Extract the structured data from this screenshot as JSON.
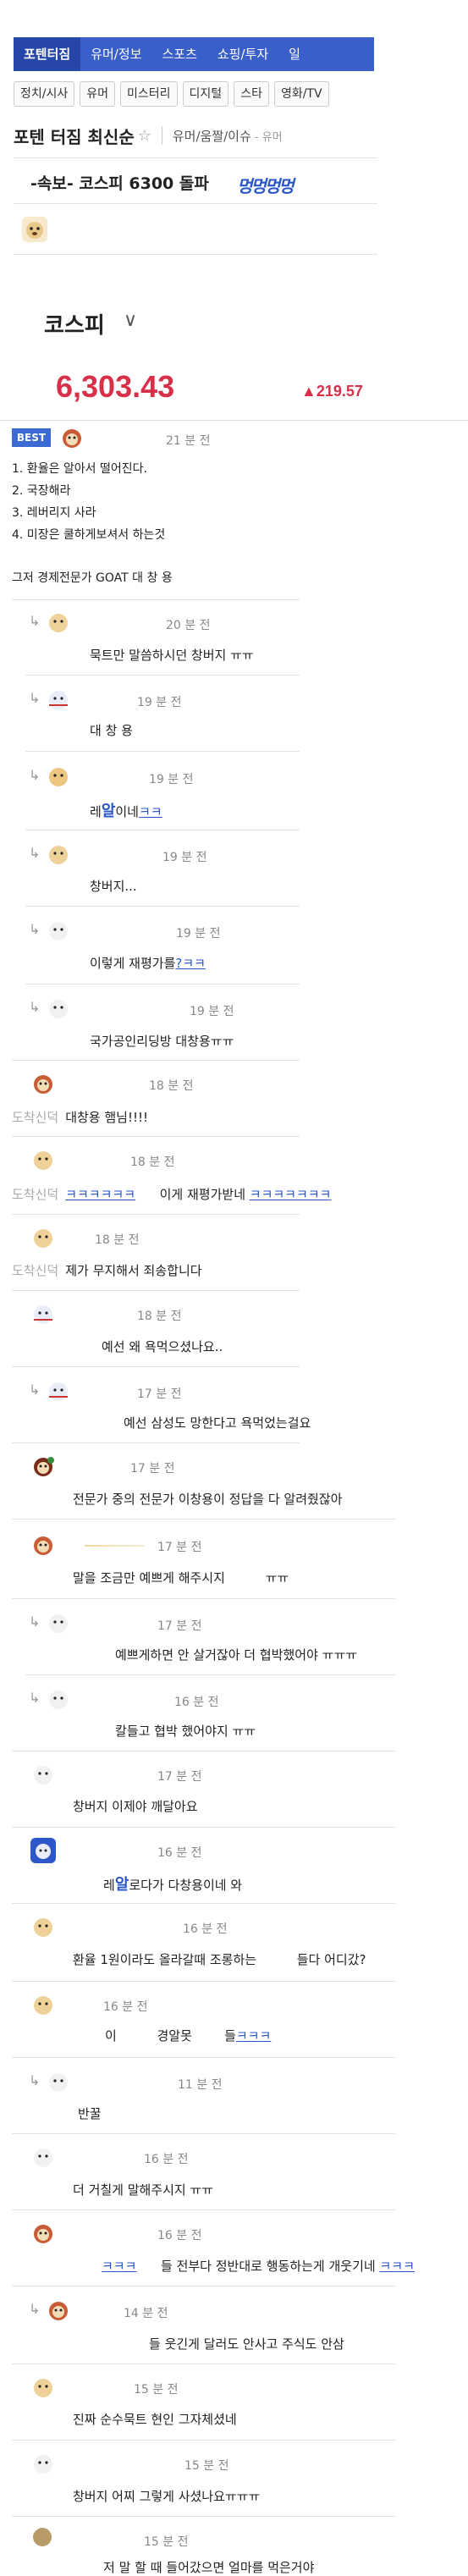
{
  "nav": {
    "tabs": [
      "포텐터짐",
      "유머/정보",
      "스포츠",
      "쇼핑/투자",
      "일"
    ],
    "chips": [
      "정치/시사",
      "유머",
      "미스터리",
      "디지털",
      "스타",
      "영화/TV"
    ]
  },
  "board": {
    "name": "포텐 터짐 최신순",
    "star": "☆",
    "category": "유머/움짤/이슈",
    "sub": "- 유머"
  },
  "post": {
    "title": "-속보- 코스피 6300 돌파",
    "title_scribble": "멍멍멍멍"
  },
  "stock": {
    "label": "코스피",
    "chevron": "∨",
    "value": "6,303.43",
    "change": "▲219.57"
  },
  "best_badge": "BEST",
  "comments": [
    {
      "time": "21 분 전",
      "lines": [
        "1. 환율은 알아서 떨어진다.",
        "2. 국장해라",
        "3. 레버리지 사라",
        "4. 미장은 쿨하게보셔서 하는것",
        "",
        "그저 경제전문가 GOAT 대 창 용"
      ]
    },
    {
      "time": "20 분 전",
      "text": "묵트만 말씀하시던 창버지 ㅠㅠ"
    },
    {
      "time": "19 분 전",
      "text": "대 창 용"
    },
    {
      "time": "19 분 전",
      "text": "레",
      "scribble": "알",
      "tail": "이네",
      "blue": "ㅋㅋ"
    },
    {
      "time": "19 분 전",
      "text": "창버지..."
    },
    {
      "time": "19 분 전",
      "text": "이렇게 재평가를",
      "blue": "?ㅋㅋ"
    },
    {
      "time": "19 분 전",
      "text": "국가공인리딩방 대창용ㅠㅠ"
    },
    {
      "time": "18 분 전",
      "nick": "도착신덕",
      "text": "대창용 햄님!!!!"
    },
    {
      "time": "18 분 전",
      "nick": "도착신덕",
      "blue": "ㅋㅋㅋㅋㅋㅋ",
      "text": "이게 재평가받네",
      "blue2": "ㅋㅋㅋㅋㅋㅋㅋ"
    },
    {
      "time": "18 분 전",
      "nick": "도착신덕",
      "text": "제가 무지해서 죄송합니다"
    },
    {
      "time": "18 분 전",
      "text": "예선 왜 욕먹으셨나요.."
    },
    {
      "time": "17 분 전",
      "text": "예선 삼성도 망한다고 욕먹었는걸요"
    },
    {
      "time": "17 분 전",
      "text": "전문가 중의 전문가 이창용이 정답을 다 알려줬잖아"
    },
    {
      "time": "17 분 전",
      "text": "말을 조금만 예쁘게 해주시지",
      "tail": "ㅠㅠ"
    },
    {
      "time": "17 분 전",
      "text": "예쁘게하면 안 살거잖아 더 협박했어야 ㅠㅠㅠ"
    },
    {
      "time": "16 분 전",
      "text": "칼들고 협박 했어야지 ㅠㅠ"
    },
    {
      "time": "17 분 전",
      "text": "창버지 이제야 깨달아요"
    },
    {
      "time": "16 분 전",
      "text": "레",
      "scribble": "알",
      "tail": "로다가 다창용이네 와"
    },
    {
      "time": "16 분 전",
      "text": "환율 1원이라도 올라갈때 조롱하는",
      "tail": "들다 어디갔?"
    },
    {
      "time": "16 분 전",
      "text": "이",
      "mid": "경알못",
      "tail": "들",
      "blue": "ㅋㅋㅋ"
    },
    {
      "time": "11 분 전",
      "text": "반꿀"
    },
    {
      "time": "16 분 전",
      "text": "더 거칠게 말해주시지 ㅠㅠ"
    },
    {
      "time": "16 분 전",
      "blue": "ㅋㅋㅋ",
      "text": "들 전부다 정반대로 행동하는게 개웃기네",
      "blue2": "ㅋㅋㅋ"
    },
    {
      "time": "14 분 전",
      "text": "들 웃긴게 달러도 안사고 주식도 안삼"
    },
    {
      "time": "15 분 전",
      "text": "진짜 순수묵트 현인 그자체셨네"
    },
    {
      "time": "15 분 전",
      "text": "창버지 어찌 그렇게 사셨나요ㅠㅠㅠ"
    },
    {
      "time": "15 분 전",
      "text": "저 말 할 때 들어갔으면 얼마를 먹은거야"
    }
  ]
}
